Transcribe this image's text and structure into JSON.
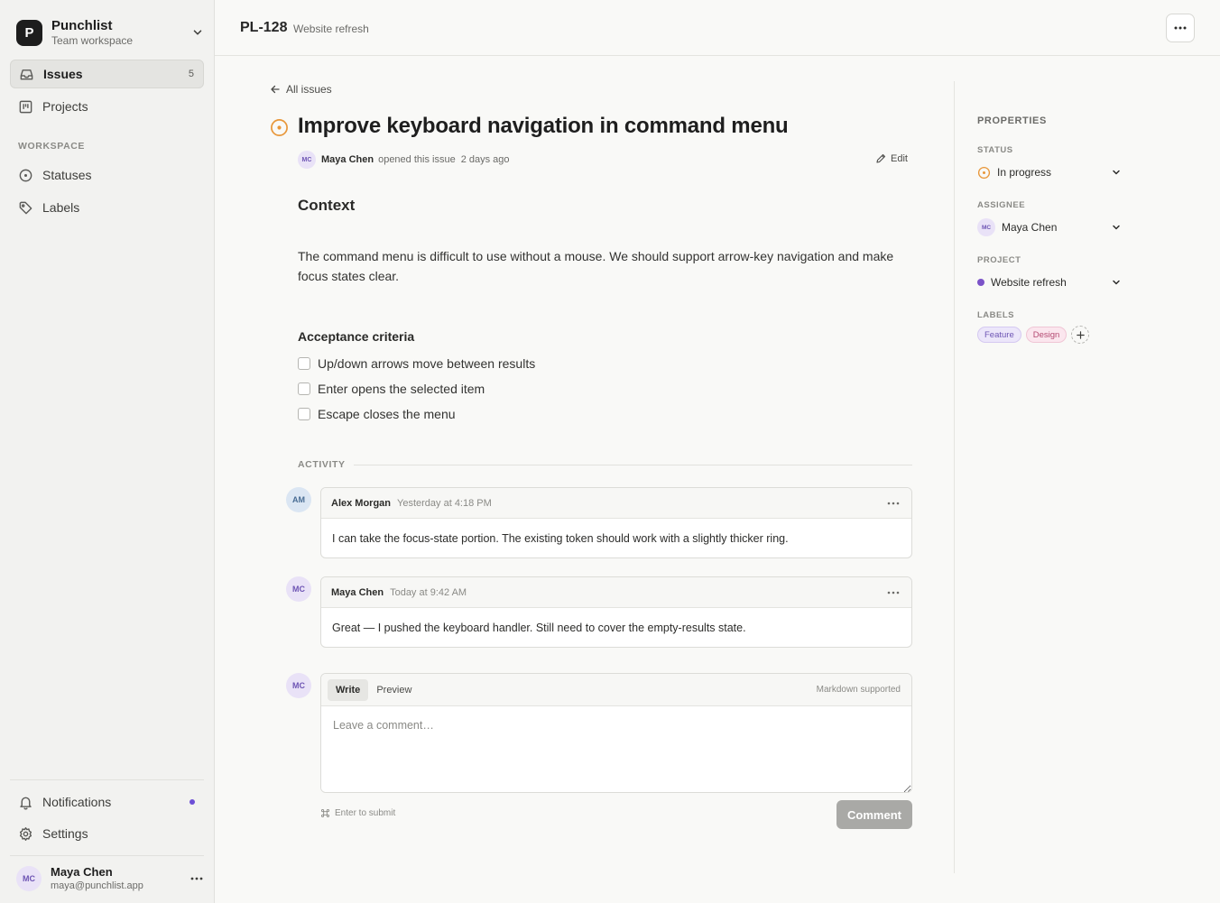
{
  "workspace": {
    "logo_letter": "P",
    "name": "Punchlist",
    "subtitle": "Team workspace"
  },
  "sidebar": {
    "nav": [
      {
        "label": "Issues",
        "badge": "5",
        "active": true
      },
      {
        "label": "Projects"
      }
    ],
    "workspace_section_label": "WORKSPACE",
    "workspace_items": [
      {
        "label": "Statuses"
      },
      {
        "label": "Labels"
      }
    ],
    "bottom_items": [
      {
        "label": "Notifications",
        "unread": true
      },
      {
        "label": "Settings"
      }
    ],
    "user": {
      "initials": "MC",
      "name": "Maya Chen",
      "email": "maya@punchlist.app"
    }
  },
  "header": {
    "issue_id": "PL-128",
    "project": "Website refresh"
  },
  "issue": {
    "back_label": "All issues",
    "title": "Improve keyboard navigation in command menu",
    "author_initials": "MC",
    "author": "Maya Chen",
    "opened_text": "opened this issue",
    "opened_time": "2 days ago",
    "edit_label": "Edit",
    "context_heading": "Context",
    "context_text": "The command menu is difficult to use without a mouse. We should support arrow-key navigation and make focus states clear.",
    "criteria_heading": "Acceptance criteria",
    "criteria": [
      {
        "text": "Up/down arrows move between results",
        "checked": false
      },
      {
        "text": "Enter opens the selected item",
        "checked": false
      },
      {
        "text": "Escape closes the menu",
        "checked": false
      }
    ]
  },
  "activity": {
    "label": "ACTIVITY",
    "comments": [
      {
        "initials": "AM",
        "author": "Alex Morgan",
        "time": "Yesterday at 4:18 PM",
        "text": "I can take the focus-state portion. The existing token should work with a slightly thicker ring."
      },
      {
        "initials": "MC",
        "author": "Maya Chen",
        "time": "Today at 9:42 AM",
        "text": "Great — I pushed the keyboard handler. Still need to cover the empty-results state."
      }
    ]
  },
  "composer": {
    "initials": "MC",
    "tab_write": "Write",
    "tab_preview": "Preview",
    "markdown_note": "Markdown supported",
    "placeholder": "Leave a comment…",
    "value": "",
    "hint": "Enter to submit",
    "submit_label": "Comment"
  },
  "properties": {
    "title": "PROPERTIES",
    "status": {
      "label": "STATUS",
      "value": "In progress"
    },
    "assignee": {
      "label": "ASSIGNEE",
      "initials": "MC",
      "value": "Maya Chen"
    },
    "project": {
      "label": "PROJECT",
      "value": "Website refresh"
    },
    "labels": {
      "label": "LABELS",
      "items": [
        "Feature",
        "Design"
      ]
    }
  },
  "colors": {
    "status_in_progress": "#e8973a",
    "project_dot": "#7b53c8",
    "notification_dot": "#6d4fd6",
    "comment_button_disabled": "#a9a9a6"
  },
  "icons": {
    "issues": "inbox-icon",
    "projects": "kanban-icon",
    "statuses": "status-circle-icon",
    "labels": "tag-icon",
    "notifications": "bell-icon",
    "settings": "gear-icon",
    "more": "ellipsis-icon",
    "back": "arrow-left-icon",
    "edit": "pencil-icon",
    "chevron": "chevron-down-icon",
    "add": "plus-icon",
    "submit_hint": "command-key-icon"
  }
}
